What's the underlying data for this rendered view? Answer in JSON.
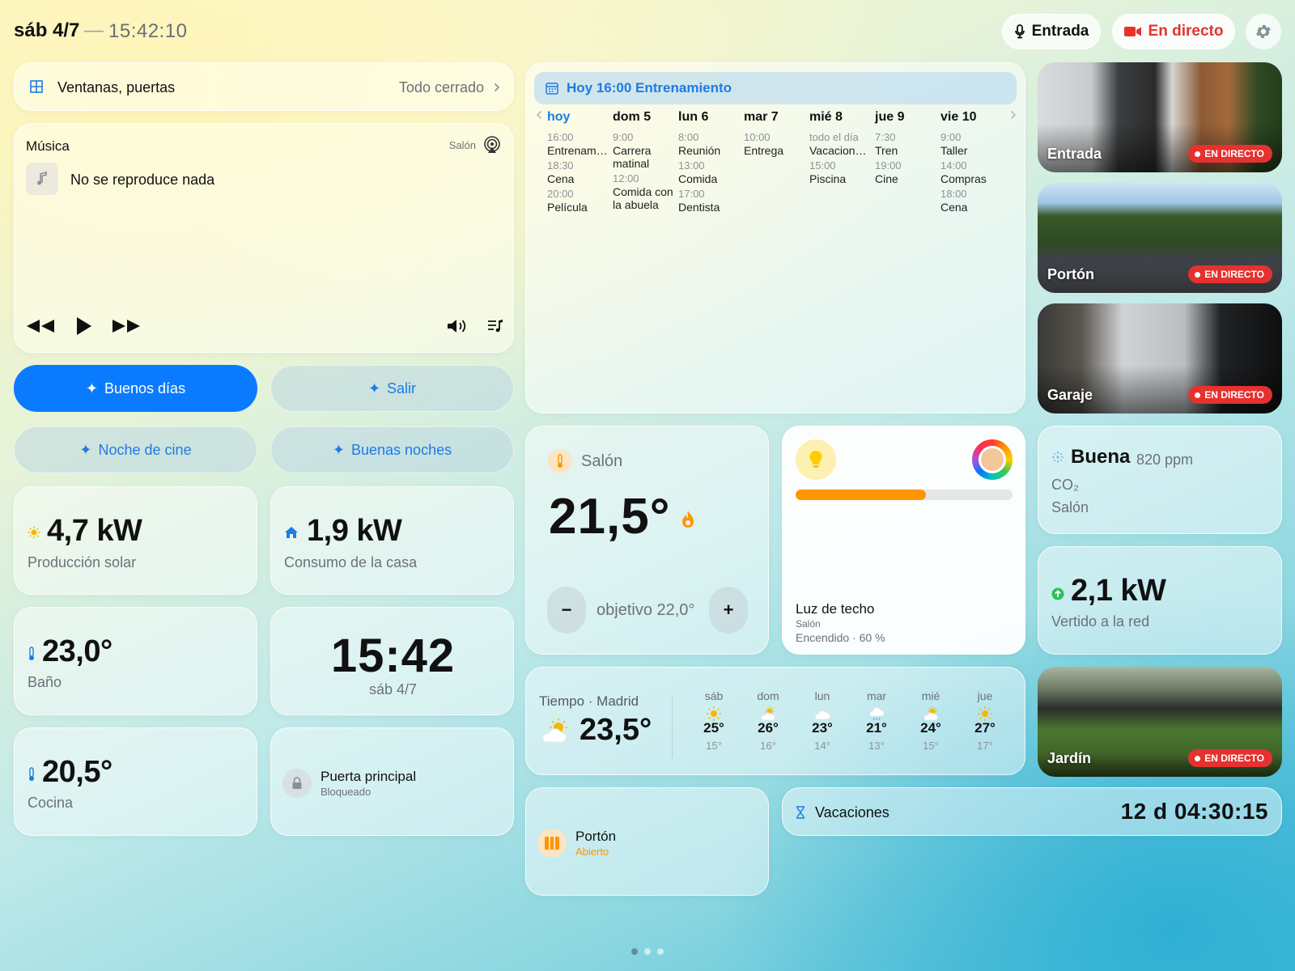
{
  "header": {
    "date": "sáb 4/7",
    "separator": "—",
    "time": "15:42:10",
    "btn_entry": "Entrada",
    "btn_live": "En directo"
  },
  "windows": {
    "title": "Ventanas, puertas",
    "status": "Todo cerrado"
  },
  "music": {
    "title": "Música",
    "room": "Salón",
    "now_playing": "No se reproduce nada"
  },
  "scenes": [
    "Buenos días",
    "Salir",
    "Noche de cine",
    "Buenas noches"
  ],
  "energy": {
    "solar_value": "4,7 kW",
    "solar_label": "Producción solar",
    "home_value": "1,9 kW",
    "home_label": "Consumo de la casa"
  },
  "bath": {
    "value": "23,0°",
    "label": "Baño"
  },
  "kitchen": {
    "value": "20,5°",
    "label": "Cocina"
  },
  "clock": {
    "time": "15:42",
    "date": "sáb 4/7"
  },
  "lock": {
    "title": "Puerta principal",
    "status": "Bloqueado"
  },
  "calendar": {
    "banner": "Hoy 16:00 Entrenamiento",
    "days": [
      {
        "label": "hoy",
        "events": [
          {
            "t": "16:00",
            "e": "Entrenam…"
          },
          {
            "t": "18:30",
            "e": "Cena"
          },
          {
            "t": "20:00",
            "e": "Película"
          }
        ]
      },
      {
        "label": "dom 5",
        "events": [
          {
            "t": "9:00",
            "e": "Carrera matinal"
          },
          {
            "t": "12:00",
            "e": "Comida con la abuela"
          }
        ]
      },
      {
        "label": "lun 6",
        "events": [
          {
            "t": "8:00",
            "e": "Reunión"
          },
          {
            "t": "13:00",
            "e": "Comida"
          },
          {
            "t": "17:00",
            "e": "Dentista"
          }
        ]
      },
      {
        "label": "mar 7",
        "events": [
          {
            "t": "10:00",
            "e": "Entrega"
          }
        ]
      },
      {
        "label": "mié 8",
        "events": [
          {
            "t": "todo el día",
            "e": "Vacacion…"
          },
          {
            "t": "15:00",
            "e": "Piscina"
          }
        ]
      },
      {
        "label": "jue 9",
        "events": [
          {
            "t": "7:30",
            "e": "Tren"
          },
          {
            "t": "19:00",
            "e": "Cine"
          }
        ]
      },
      {
        "label": "vie 10",
        "events": [
          {
            "t": "9:00",
            "e": "Taller"
          },
          {
            "t": "14:00",
            "e": "Compras"
          },
          {
            "t": "18:00",
            "e": "Cena"
          }
        ]
      }
    ]
  },
  "thermostat": {
    "room": "Salón",
    "temp": "21,5°",
    "target": "objetivo 22,0°",
    "minus": "−",
    "plus": "+"
  },
  "light": {
    "name": "Luz de techo",
    "room": "Salón",
    "status": "Encendido · 60 %",
    "level": 0.6
  },
  "weather": {
    "title": "Tiempo · Madrid",
    "temp": "23,5°",
    "forecast": [
      {
        "d": "sáb",
        "hi": "25°",
        "lo": "15°",
        "icon": "sun-icon"
      },
      {
        "d": "dom",
        "hi": "26°",
        "lo": "16°",
        "icon": "partly-cloudy-icon"
      },
      {
        "d": "lun",
        "hi": "23°",
        "lo": "14°",
        "icon": "cloud-icon"
      },
      {
        "d": "mar",
        "hi": "21°",
        "lo": "13°",
        "icon": "rain-icon"
      },
      {
        "d": "mié",
        "hi": "24°",
        "lo": "15°",
        "icon": "partly-cloudy-icon"
      },
      {
        "d": "jue",
        "hi": "27°",
        "lo": "17°",
        "icon": "sun-icon"
      }
    ]
  },
  "gate": {
    "title": "Portón",
    "status": "Abierto"
  },
  "vacation": {
    "label": "Vacaciones",
    "countdown": "12 d 04:30:15"
  },
  "co2": {
    "quality": "Buena",
    "value": "820 ppm",
    "label": "CO₂",
    "room": "Salón"
  },
  "grid": {
    "value": "2,1 kW",
    "label": "Vertido a la red"
  },
  "cameras": {
    "badge": "EN DIRECTO",
    "names": [
      "Entrada",
      "Portón",
      "Garaje",
      "Jardín"
    ]
  },
  "colors": {
    "accent": "#0a7bff",
    "live": "#e5322f",
    "orange": "#ff9500",
    "green": "#2fbf5a"
  }
}
